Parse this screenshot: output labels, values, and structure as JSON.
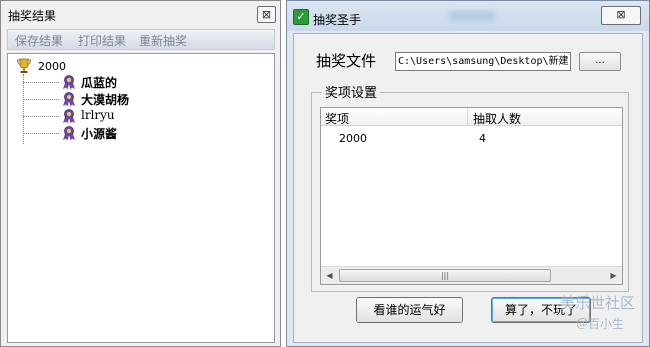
{
  "left_window": {
    "title": "抽奖结果",
    "close_glyph": "⊠",
    "toolbar": [
      "保存结果",
      "打印结果",
      "重新抽奖"
    ],
    "tree": {
      "root": "2000",
      "root_icon": "trophy-icon",
      "item_icon": "prize-ribbon-icon",
      "items": [
        "瓜蓝的",
        "大漠胡杨",
        "lrlryu",
        "小源酱"
      ]
    }
  },
  "right_window": {
    "title": "抽奖圣手",
    "app_icon_glyph": "✓",
    "close_glyph": "⊠",
    "file_label": "抽奖文件",
    "file_path": "C:\\Users\\samsung\\Desktop\\新建",
    "browse_label": "...",
    "group_title": "奖项设置",
    "columns": [
      "奖项",
      "抽取人数"
    ],
    "rows": [
      {
        "prize": "2000",
        "count": "4"
      }
    ],
    "scroll_left_glyph": "◀",
    "scroll_right_glyph": "▶",
    "scroll_thumb_glyph": "|||",
    "lucky_button": "看谁的运气好",
    "quit_button": "算了，不玩了"
  },
  "watermark": {
    "line1": "美乐世社区",
    "line2": "＠百小生"
  },
  "colors": {
    "toolbar_text": "#7d8591",
    "app_icon": "#2e9b3a",
    "watermark": "#9ab2c8"
  }
}
